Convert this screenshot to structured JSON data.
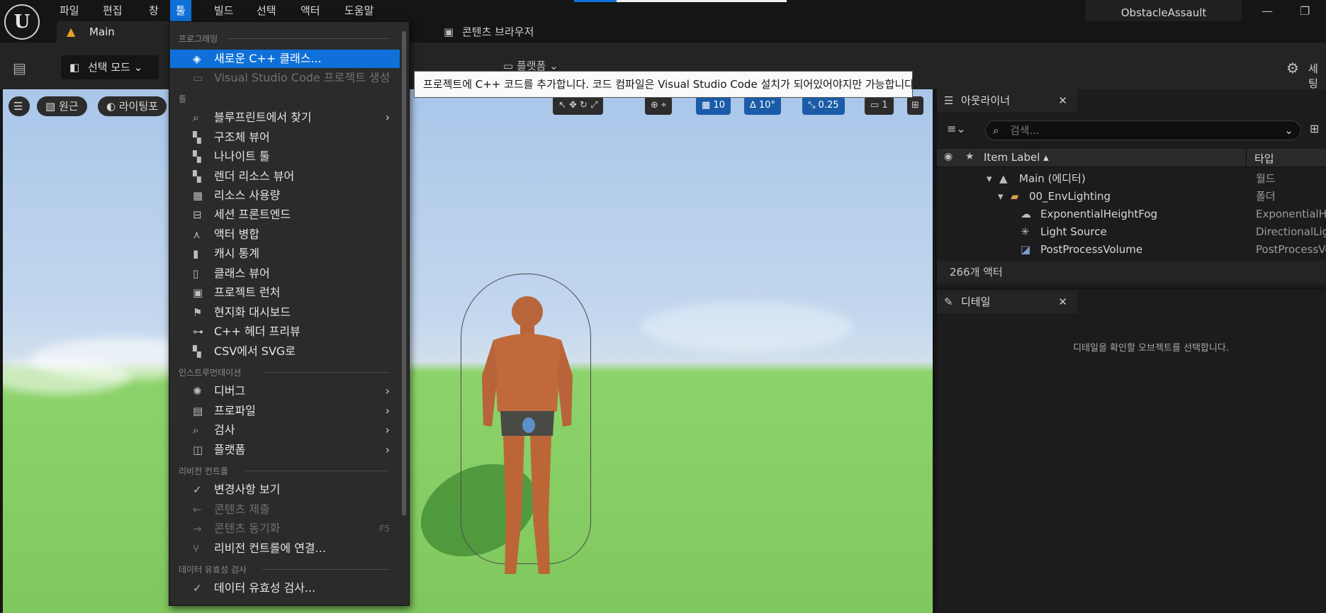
{
  "app": {
    "logo_text": "U",
    "project_name": "ObstacleAssault",
    "minimize": "—",
    "restore": "❐"
  },
  "menubar": [
    "파일",
    "편집",
    "창",
    "툴",
    "빌드",
    "선택",
    "액터",
    "도움말"
  ],
  "tabs": {
    "main": "Main",
    "content_browser": "콘텐츠 브라우저"
  },
  "toolbar": {
    "mode": "선택 모드",
    "platform": "플랫폼",
    "settings": "세팅"
  },
  "viewport": {
    "perspective": "원근",
    "lighting": "라이팅포",
    "snap_grid": "10",
    "snap_angle": "10°",
    "snap_scale": "0.25",
    "camera_speed": "1"
  },
  "dropdown": {
    "sections": {
      "programming": "프로그래밍",
      "tools": "툴",
      "instrumentation": "인스트루먼테이션",
      "revision": "리비전 컨트롤",
      "validation": "데이터 유효성 검사"
    },
    "items": [
      {
        "label": "새로운 C++ 클래스...",
        "icon": "cpp-class-icon"
      },
      {
        "label": "Visual Studio Code 프로젝트 생성",
        "icon": "vscode-icon"
      },
      {
        "label": "블루프린트에서 찾기",
        "icon": "find-icon"
      },
      {
        "label": "구조체 뷰어",
        "icon": "struct-icon"
      },
      {
        "label": "나나이트 툴",
        "icon": "nanite-icon"
      },
      {
        "label": "렌더 리소스 뷰어",
        "icon": "render-icon"
      },
      {
        "label": "리소스 사용량",
        "icon": "table-icon"
      },
      {
        "label": "세션 프론트엔드",
        "icon": "session-icon"
      },
      {
        "label": "액터 병합",
        "icon": "merge-icon"
      },
      {
        "label": "캐시 통계",
        "icon": "stats-icon"
      },
      {
        "label": "클래스 뷰어",
        "icon": "class-icon"
      },
      {
        "label": "프로젝트 런처",
        "icon": "launcher-icon"
      },
      {
        "label": "현지화 대시보드",
        "icon": "flag-icon"
      },
      {
        "label": "C++ 헤더 프리뷰",
        "icon": "header-icon"
      },
      {
        "label": "CSV에서 SVG로",
        "icon": "csv-icon"
      },
      {
        "label": "디버그",
        "icon": "debug-icon"
      },
      {
        "label": "프로파일",
        "icon": "profile-icon"
      },
      {
        "label": "검사",
        "icon": "inspect-icon"
      },
      {
        "label": "플랫폼",
        "icon": "platform-icon"
      },
      {
        "label": "변경사항 보기",
        "icon": "check-icon"
      },
      {
        "label": "콘텐츠 제출",
        "icon": "arrow-left-icon"
      },
      {
        "label": "콘텐츠 동기화",
        "icon": "arrow-right-icon",
        "shortcut": "F5"
      },
      {
        "label": "리비전 컨트롤에 연결...",
        "icon": "branch-icon"
      },
      {
        "label": "데이터 유효성 검사...",
        "icon": "validate-icon"
      }
    ]
  },
  "tooltip": "프로젝트에 C++ 코드를 추가합니다. 코드 컴파일은 Visual Studio Code 설치가 되어있어야지만 가능합니다.",
  "outliner": {
    "title": "아웃라이너",
    "search_placeholder": "검색...",
    "col_label": "Item Label",
    "col_type": "타입",
    "rows": [
      {
        "label": "Main (에디터)",
        "type": "월드"
      },
      {
        "label": "00_EnvLighting",
        "type": "폴더"
      },
      {
        "label": "ExponentialHeightFog",
        "type": "ExponentialHeightFog"
      },
      {
        "label": "Light Source",
        "type": "DirectionalLight"
      },
      {
        "label": "PostProcessVolume",
        "type": "PostProcessVolume"
      }
    ],
    "count": "266개 액터"
  },
  "details": {
    "title": "디테일",
    "hint": "디테일을 확인할 오브젝트를 선택합니다."
  },
  "colors": {
    "accent": "#0e70d8",
    "bg": "#151515",
    "panel": "#242424",
    "sky": "#b6cfea",
    "grass": "#84cc60"
  }
}
